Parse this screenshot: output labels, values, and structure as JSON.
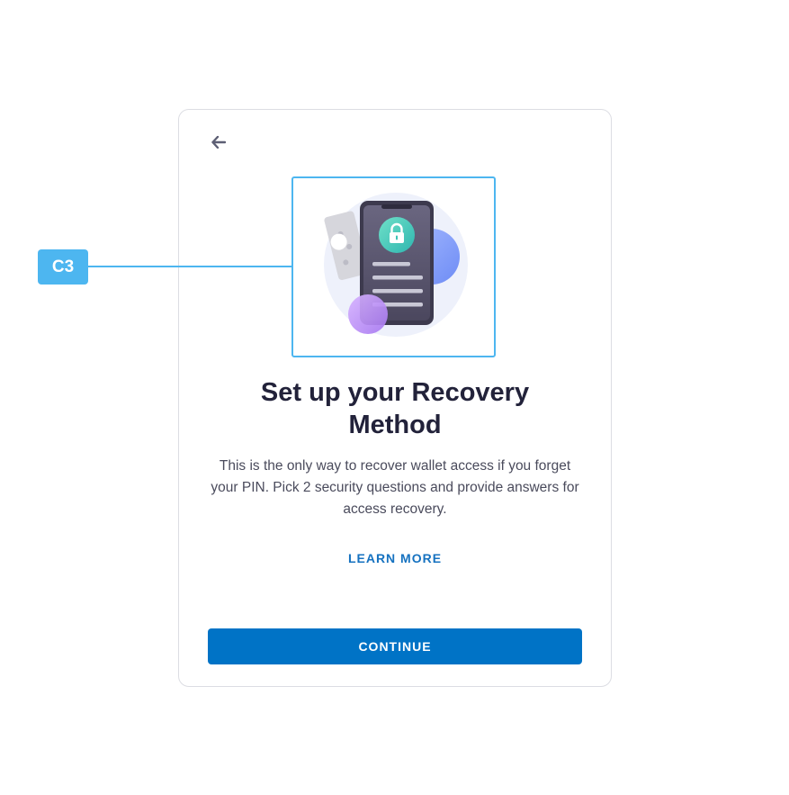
{
  "annotation": {
    "label": "C3",
    "color": "#4db6f0"
  },
  "header": {
    "back_icon": "arrow-left-icon"
  },
  "illustration": {
    "name": "phone-lock-illustration",
    "icons": [
      "lock-icon",
      "phone-icon",
      "key-icon"
    ]
  },
  "content": {
    "title": "Set up your Recovery Method",
    "description": "This is the only way to recover wallet access if you forget your PIN. Pick 2 security questions and provide answers for access recovery.",
    "learn_more": "LEARN MORE"
  },
  "footer": {
    "continue_label": "CONTINUE"
  },
  "colors": {
    "primary": "#0073c6",
    "link": "#1672c0",
    "title": "#22223a",
    "body": "#4a4b5c",
    "annotation": "#4db6f0"
  }
}
